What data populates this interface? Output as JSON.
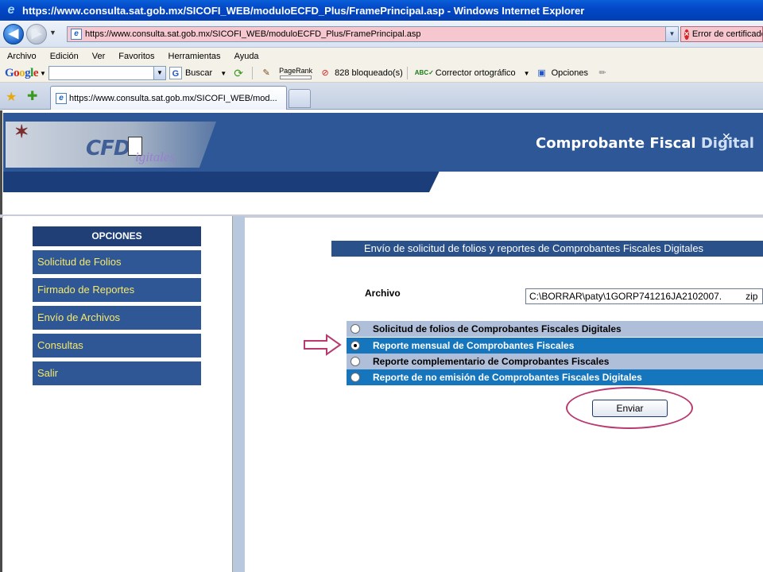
{
  "window": {
    "title": "https://www.consulta.sat.gob.mx/SICOFI_WEB/moduloECFD_Plus/FramePrincipal.asp - Windows Internet Explorer"
  },
  "address_bar": {
    "url": "https://www.consulta.sat.gob.mx/SICOFI_WEB/moduloECFD_Plus/FramePrincipal.asp",
    "cert_error": "Error de certificado"
  },
  "menu": [
    "Archivo",
    "Edición",
    "Ver",
    "Favoritos",
    "Herramientas",
    "Ayuda"
  ],
  "google_toolbar": {
    "logo": "Google",
    "search_value": "",
    "buscar": "Buscar",
    "pagerank": "PageRank",
    "blocked": "828 bloqueado(s)",
    "spell": "Corrector ortográfico",
    "options": "Opciones"
  },
  "tab": {
    "title": "https://www.consulta.sat.gob.mx/SICOFI_WEB/mod..."
  },
  "banner": {
    "cfd": "CFD",
    "igitales": "igitales",
    "title_main": "Comprobante Fiscal ",
    "title_accent": "Digital"
  },
  "sidebar": {
    "header": "OPCIONES",
    "items": [
      "Solicitud de Folios",
      "Firmado de Reportes",
      "Envío de Archivos",
      "Consultas",
      "Salir"
    ]
  },
  "main": {
    "heading": "Envío de solicitud de folios y reportes de Comprobantes Fiscales Digitales",
    "file_label": "Archivo",
    "file_value_path": "C:\\BORRAR\\paty\\1GORP741216JA2102007.",
    "file_value_ext": "zip",
    "options": [
      {
        "label": "Solicitud de folios de Comprobantes Fiscales Digitales",
        "checked": false
      },
      {
        "label": "Reporte mensual de Comprobantes Fiscales",
        "checked": true
      },
      {
        "label": "Reporte complementario de Comprobantes Fiscales",
        "checked": false
      },
      {
        "label": "Reporte de no emisión de Comprobantes Fiscales Digitales",
        "checked": false
      }
    ],
    "submit": "Enviar"
  },
  "colors": {
    "banner_blue": "#2d5796",
    "menu_item_bg": "#2f5796",
    "menu_item_text": "#f6e96a",
    "option_light": "#b0bfd9",
    "option_dark": "#1575bd",
    "annotation": "#b83a70"
  }
}
